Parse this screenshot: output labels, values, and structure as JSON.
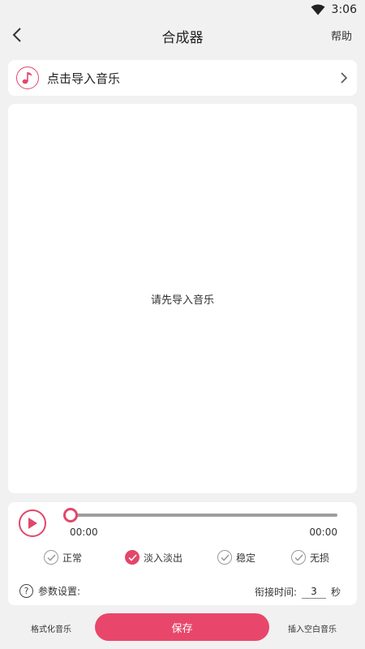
{
  "status_bar": {
    "time": "3:06",
    "icons": [
      "wifi-icon"
    ]
  },
  "header": {
    "title": "合成器",
    "help_label": "帮助",
    "back_icon": "chevron-left-icon"
  },
  "import": {
    "label": "点击导入音乐",
    "icon": "music-note-icon",
    "arrow_icon": "chevron-right-icon"
  },
  "empty_state": {
    "message": "请先导入音乐"
  },
  "player": {
    "play_icon": "play-icon",
    "current_time": "00:00",
    "total_time": "00:00",
    "progress": 0
  },
  "modes": [
    {
      "label": "正常",
      "checked": false
    },
    {
      "label": "淡入淡出",
      "checked": true
    },
    {
      "label": "稳定",
      "checked": false
    },
    {
      "label": "无损",
      "checked": false
    }
  ],
  "settings": {
    "params_label": "参数设置:",
    "help_icon": "question-icon",
    "gap_label": "衔接时间:",
    "gap_value": "3",
    "gap_unit": "秒"
  },
  "bottom": {
    "format_label": "格式化音乐",
    "save_label": "保存",
    "insert_label": "插入空白音乐"
  },
  "colors": {
    "accent": "#e2476a",
    "background": "#f1f1f1",
    "track": "#9e9e9e"
  }
}
